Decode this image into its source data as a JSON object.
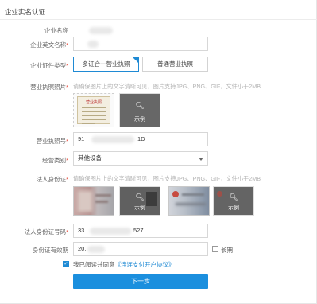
{
  "page": {
    "title": "企业实名认证"
  },
  "fields": {
    "company_name": {
      "label": "企业名称"
    },
    "company_en_name": {
      "label": "企业英文名称",
      "required": "*"
    },
    "cert_type": {
      "label": "企业证件类型",
      "required": "*",
      "options": [
        "多证合一营业执照",
        "普通营业执照"
      ],
      "selected_index": 0
    },
    "license_photo": {
      "label": "营业执照照片",
      "required": "*",
      "hint": "请确保图片上的文字清晰可见，图片支持JPG、PNG、GIF，文件小于2MB",
      "sample_label": "示例"
    },
    "license_no": {
      "label": "营业执照号",
      "required": "*",
      "value_prefix": "91",
      "value_suffix": "1D"
    },
    "business_type": {
      "label": "经营类别",
      "required": "*",
      "value": "其他设备"
    },
    "legal_id_photo": {
      "label": "法人身份证",
      "required": "*",
      "hint": "请确保图片上的文字清晰可见，图片支持JPG、PNG、GIF，文件小于2MB",
      "sample_label": "示例"
    },
    "legal_id_no": {
      "label": "法人身份证号码",
      "required": "*",
      "value_prefix": "33",
      "value_suffix": "527"
    },
    "id_validity": {
      "label": "身份证有效期",
      "value_prefix": "20.",
      "long_term_label": "长期"
    }
  },
  "agreement": {
    "prefix": "我已阅读并同意",
    "link": "《连连支付开户协议》",
    "checked": true
  },
  "actions": {
    "next_label": "下一步"
  },
  "colors": {
    "accent": "#1b8fde",
    "required": "#e64b3b"
  }
}
